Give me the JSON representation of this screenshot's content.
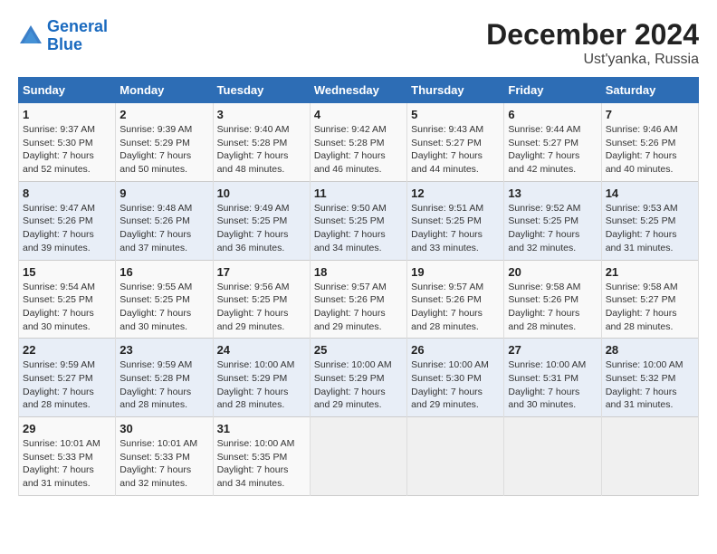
{
  "header": {
    "logo_line1": "General",
    "logo_line2": "Blue",
    "month_title": "December 2024",
    "subtitle": "Ust'yanka, Russia"
  },
  "weekdays": [
    "Sunday",
    "Monday",
    "Tuesday",
    "Wednesday",
    "Thursday",
    "Friday",
    "Saturday"
  ],
  "weeks": [
    [
      {
        "day": "1",
        "info": "Sunrise: 9:37 AM\nSunset: 5:30 PM\nDaylight: 7 hours\nand 52 minutes."
      },
      {
        "day": "2",
        "info": "Sunrise: 9:39 AM\nSunset: 5:29 PM\nDaylight: 7 hours\nand 50 minutes."
      },
      {
        "day": "3",
        "info": "Sunrise: 9:40 AM\nSunset: 5:28 PM\nDaylight: 7 hours\nand 48 minutes."
      },
      {
        "day": "4",
        "info": "Sunrise: 9:42 AM\nSunset: 5:28 PM\nDaylight: 7 hours\nand 46 minutes."
      },
      {
        "day": "5",
        "info": "Sunrise: 9:43 AM\nSunset: 5:27 PM\nDaylight: 7 hours\nand 44 minutes."
      },
      {
        "day": "6",
        "info": "Sunrise: 9:44 AM\nSunset: 5:27 PM\nDaylight: 7 hours\nand 42 minutes."
      },
      {
        "day": "7",
        "info": "Sunrise: 9:46 AM\nSunset: 5:26 PM\nDaylight: 7 hours\nand 40 minutes."
      }
    ],
    [
      {
        "day": "8",
        "info": "Sunrise: 9:47 AM\nSunset: 5:26 PM\nDaylight: 7 hours\nand 39 minutes."
      },
      {
        "day": "9",
        "info": "Sunrise: 9:48 AM\nSunset: 5:26 PM\nDaylight: 7 hours\nand 37 minutes."
      },
      {
        "day": "10",
        "info": "Sunrise: 9:49 AM\nSunset: 5:25 PM\nDaylight: 7 hours\nand 36 minutes."
      },
      {
        "day": "11",
        "info": "Sunrise: 9:50 AM\nSunset: 5:25 PM\nDaylight: 7 hours\nand 34 minutes."
      },
      {
        "day": "12",
        "info": "Sunrise: 9:51 AM\nSunset: 5:25 PM\nDaylight: 7 hours\nand 33 minutes."
      },
      {
        "day": "13",
        "info": "Sunrise: 9:52 AM\nSunset: 5:25 PM\nDaylight: 7 hours\nand 32 minutes."
      },
      {
        "day": "14",
        "info": "Sunrise: 9:53 AM\nSunset: 5:25 PM\nDaylight: 7 hours\nand 31 minutes."
      }
    ],
    [
      {
        "day": "15",
        "info": "Sunrise: 9:54 AM\nSunset: 5:25 PM\nDaylight: 7 hours\nand 30 minutes."
      },
      {
        "day": "16",
        "info": "Sunrise: 9:55 AM\nSunset: 5:25 PM\nDaylight: 7 hours\nand 30 minutes."
      },
      {
        "day": "17",
        "info": "Sunrise: 9:56 AM\nSunset: 5:25 PM\nDaylight: 7 hours\nand 29 minutes."
      },
      {
        "day": "18",
        "info": "Sunrise: 9:57 AM\nSunset: 5:26 PM\nDaylight: 7 hours\nand 29 minutes."
      },
      {
        "day": "19",
        "info": "Sunrise: 9:57 AM\nSunset: 5:26 PM\nDaylight: 7 hours\nand 28 minutes."
      },
      {
        "day": "20",
        "info": "Sunrise: 9:58 AM\nSunset: 5:26 PM\nDaylight: 7 hours\nand 28 minutes."
      },
      {
        "day": "21",
        "info": "Sunrise: 9:58 AM\nSunset: 5:27 PM\nDaylight: 7 hours\nand 28 minutes."
      }
    ],
    [
      {
        "day": "22",
        "info": "Sunrise: 9:59 AM\nSunset: 5:27 PM\nDaylight: 7 hours\nand 28 minutes."
      },
      {
        "day": "23",
        "info": "Sunrise: 9:59 AM\nSunset: 5:28 PM\nDaylight: 7 hours\nand 28 minutes."
      },
      {
        "day": "24",
        "info": "Sunrise: 10:00 AM\nSunset: 5:29 PM\nDaylight: 7 hours\nand 28 minutes."
      },
      {
        "day": "25",
        "info": "Sunrise: 10:00 AM\nSunset: 5:29 PM\nDaylight: 7 hours\nand 29 minutes."
      },
      {
        "day": "26",
        "info": "Sunrise: 10:00 AM\nSunset: 5:30 PM\nDaylight: 7 hours\nand 29 minutes."
      },
      {
        "day": "27",
        "info": "Sunrise: 10:00 AM\nSunset: 5:31 PM\nDaylight: 7 hours\nand 30 minutes."
      },
      {
        "day": "28",
        "info": "Sunrise: 10:00 AM\nSunset: 5:32 PM\nDaylight: 7 hours\nand 31 minutes."
      }
    ],
    [
      {
        "day": "29",
        "info": "Sunrise: 10:01 AM\nSunset: 5:33 PM\nDaylight: 7 hours\nand 31 minutes."
      },
      {
        "day": "30",
        "info": "Sunrise: 10:01 AM\nSunset: 5:33 PM\nDaylight: 7 hours\nand 32 minutes."
      },
      {
        "day": "31",
        "info": "Sunrise: 10:00 AM\nSunset: 5:35 PM\nDaylight: 7 hours\nand 34 minutes."
      },
      {
        "day": "",
        "info": ""
      },
      {
        "day": "",
        "info": ""
      },
      {
        "day": "",
        "info": ""
      },
      {
        "day": "",
        "info": ""
      }
    ]
  ]
}
